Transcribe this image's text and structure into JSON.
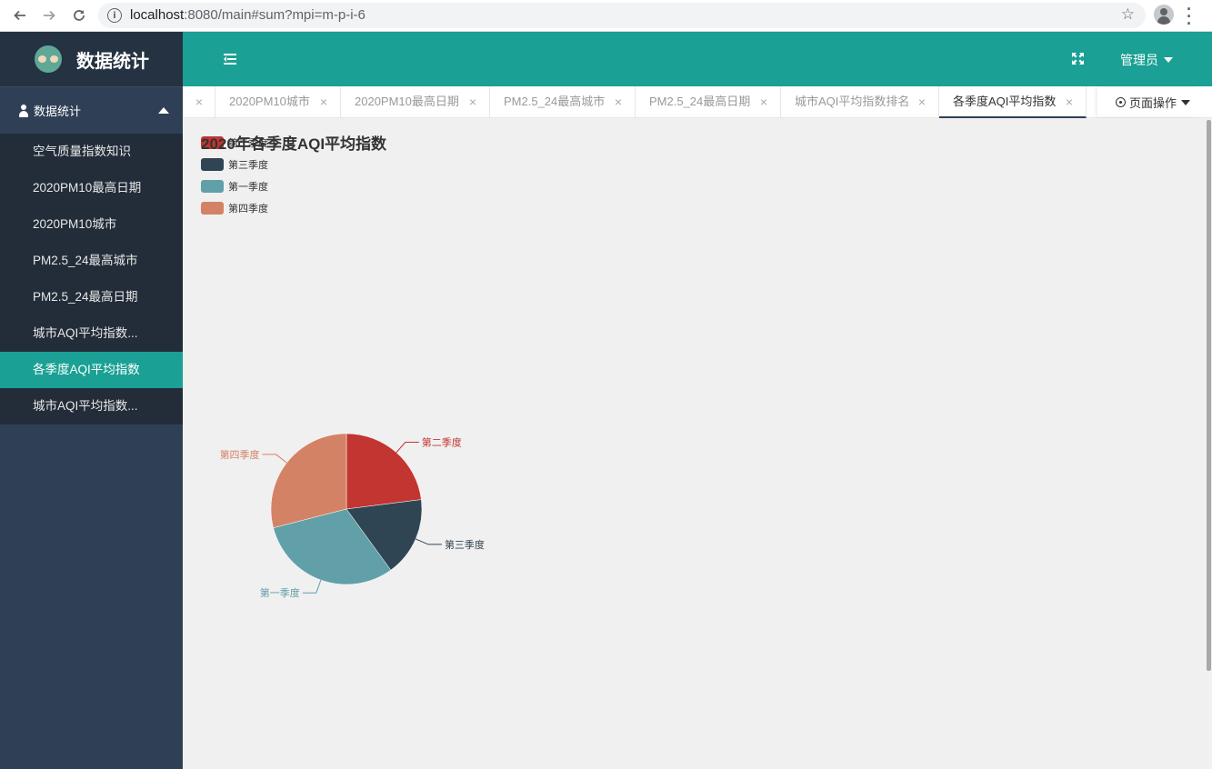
{
  "browser": {
    "url_host": "localhost",
    "url_rest": ":8080/main#sum?mpi=m-p-i-6"
  },
  "sidebar": {
    "logo_text": "数据统计",
    "group_label": "数据统计",
    "items": [
      {
        "label": "空气质量指数知识",
        "active": false
      },
      {
        "label": "2020PM10最高日期",
        "active": false
      },
      {
        "label": "2020PM10城市",
        "active": false
      },
      {
        "label": "PM2.5_24最高城市",
        "active": false
      },
      {
        "label": "PM2.5_24最高日期",
        "active": false
      },
      {
        "label": "城市AQI平均指数...",
        "active": false
      },
      {
        "label": "各季度AQI平均指数",
        "active": true
      },
      {
        "label": "城市AQI平均指数...",
        "active": false
      }
    ]
  },
  "header": {
    "admin_label": "管理员"
  },
  "tabs": {
    "items": [
      {
        "label": "2020PM10城市"
      },
      {
        "label": "2020PM10最高日期"
      },
      {
        "label": "PM2.5_24最高城市"
      },
      {
        "label": "PM2.5_24最高日期"
      },
      {
        "label": "城市AQI平均指数排名"
      },
      {
        "label": "各季度AQI平均指数"
      }
    ],
    "close_glyph": "×",
    "page_ops_label": "页面操作"
  },
  "chart_data": {
    "type": "pie",
    "title": "2020年各季度AQI平均指数",
    "legend_position": "top-left",
    "slices": [
      {
        "name": "第二季度",
        "value": 23,
        "color": "#c23531"
      },
      {
        "name": "第三季度",
        "value": 17,
        "color": "#2f4554"
      },
      {
        "name": "第一季度",
        "value": 31,
        "color": "#61a0a8"
      },
      {
        "name": "第四季度",
        "value": 29,
        "color": "#d48265"
      }
    ]
  }
}
